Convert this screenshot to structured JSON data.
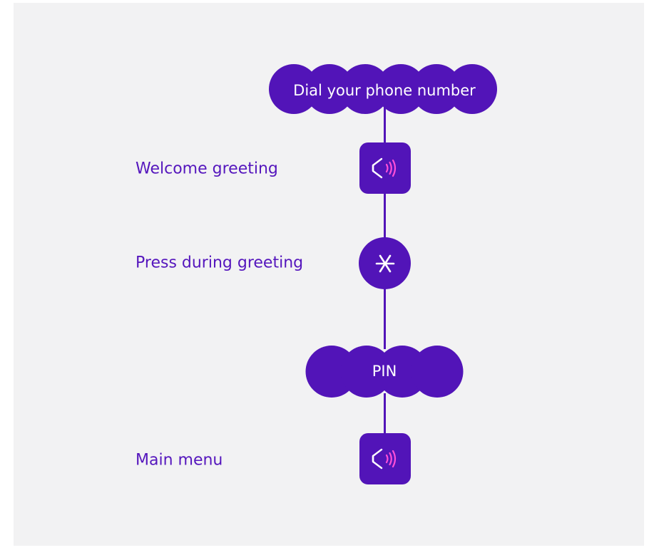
{
  "flow": {
    "start_label": "Dial your phone number",
    "steps": [
      {
        "label": "Welcome greeting",
        "icon": "speaker-icon"
      },
      {
        "label": "Press during greeting",
        "icon": "asterisk-icon"
      },
      {
        "label": "Main menu",
        "icon": "speaker-icon"
      }
    ],
    "pin_label": "PIN"
  },
  "colors": {
    "accent": "#5214b8",
    "label_text": "#5516bd",
    "sound_waves": "#ff4fd8",
    "background": "#f2f2f3"
  }
}
